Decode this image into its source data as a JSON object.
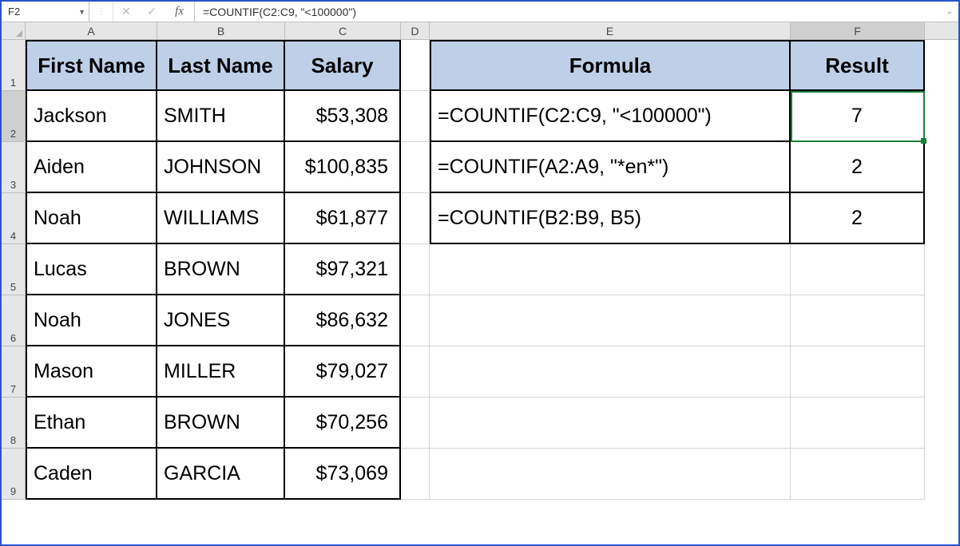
{
  "formula_bar": {
    "name_box": "F2",
    "cancel_symbol": "✕",
    "enter_symbol": "✓",
    "fx_label": "fx",
    "formula": "=COUNTIF(C2:C9, \"<100000\")"
  },
  "columns": [
    "A",
    "B",
    "C",
    "D",
    "E",
    "F"
  ],
  "row_labels": [
    "1",
    "2",
    "3",
    "4",
    "5",
    "6",
    "7",
    "8",
    "9"
  ],
  "selected_cell": "F2",
  "headers": {
    "first_name": "First Name",
    "last_name": "Last Name",
    "salary": "Salary",
    "formula": "Formula",
    "result": "Result"
  },
  "people": [
    {
      "first": "Jackson",
      "last": "SMITH",
      "salary": "$53,308"
    },
    {
      "first": "Aiden",
      "last": "JOHNSON",
      "salary": "$100,835"
    },
    {
      "first": "Noah",
      "last": "WILLIAMS",
      "salary": "$61,877"
    },
    {
      "first": "Lucas",
      "last": "BROWN",
      "salary": "$97,321"
    },
    {
      "first": "Noah",
      "last": "JONES",
      "salary": "$86,632"
    },
    {
      "first": "Mason",
      "last": "MILLER",
      "salary": "$79,027"
    },
    {
      "first": "Ethan",
      "last": "BROWN",
      "salary": "$70,256"
    },
    {
      "first": "Caden",
      "last": "GARCIA",
      "salary": "$73,069"
    }
  ],
  "formulas": [
    {
      "formula": "=COUNTIF(C2:C9, \"<100000\")",
      "result": "7"
    },
    {
      "formula": "=COUNTIF(A2:A9, \"*en*\")",
      "result": "2"
    },
    {
      "formula": "=COUNTIF(B2:B9, B5)",
      "result": "2"
    }
  ]
}
